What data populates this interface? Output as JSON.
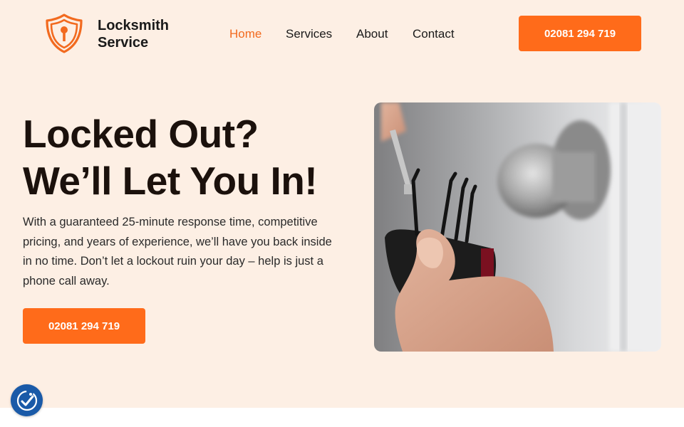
{
  "brand": {
    "name_line1": "Locksmith",
    "name_line2": "Service",
    "logo_icon": "shield-keyhole-icon",
    "accent_color": "#f26a1f"
  },
  "nav": {
    "items": [
      {
        "label": "Home",
        "active": true
      },
      {
        "label": "Services",
        "active": false
      },
      {
        "label": "About",
        "active": false
      },
      {
        "label": "Contact",
        "active": false
      }
    ]
  },
  "header": {
    "phone_button_label": "02081 294 719"
  },
  "hero": {
    "title_line1": "Locked Out?",
    "title_line2": "We’ll Let You In!",
    "description": "With a guaranteed 25-minute response time, competitive pricing, and years of experience, we’ll have you back inside in no time. Don’t let a lockout ruin your day – help is just a phone call away.",
    "phone_button_label": "02081 294 719",
    "image_subject": "hand-picking-door-lock-photo"
  },
  "accessibility": {
    "icon": "accessibility-check-icon"
  },
  "colors": {
    "background": "#fdefe4",
    "button": "#ff6b1a",
    "heading": "#1b110c",
    "accessibility_button": "#1a5aa8"
  }
}
